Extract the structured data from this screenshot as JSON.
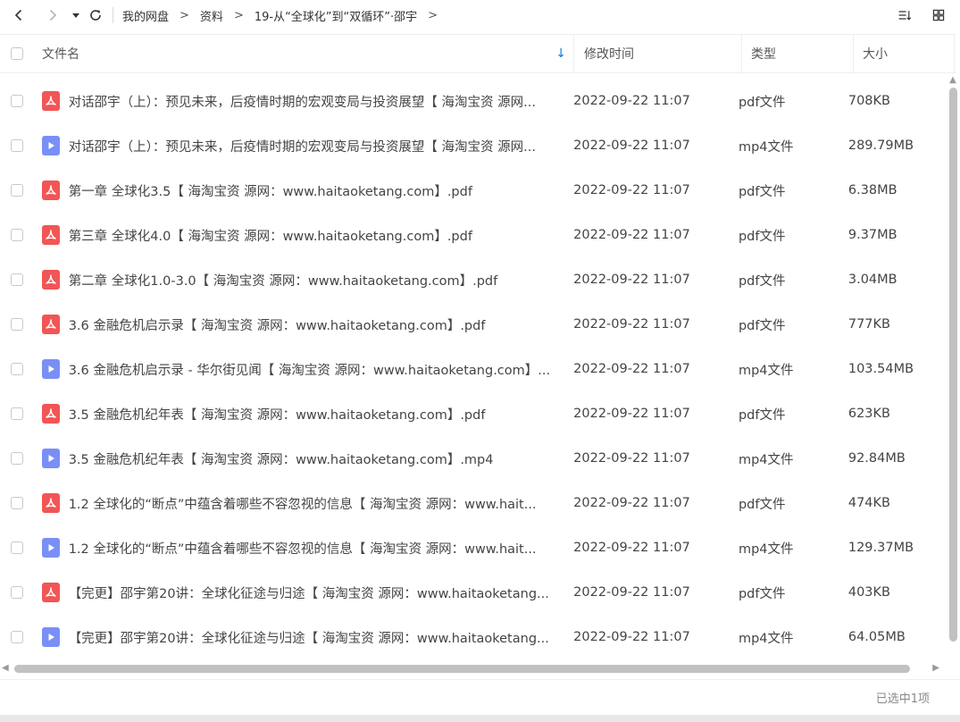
{
  "toolbar": {
    "back_icon": "chevron-left-icon",
    "forward_icon": "chevron-right-icon",
    "history_icon": "caret-down-icon",
    "refresh_icon": "refresh-icon",
    "breadcrumbs": [
      "我的网盘",
      "资料",
      "19-从“全球化”到“双循环”·邵宇"
    ],
    "sort_icon": "sort-list-icon",
    "grid_icon": "grid-view-icon"
  },
  "header": {
    "name": "文件名",
    "time": "修改时间",
    "type": "类型",
    "size": "大小"
  },
  "files": [
    {
      "name": "对话邵宇（上）：预见未来，后疫情时期的宏观变局与投资展望【 海淘宝资 源网...",
      "time": "2022-09-22 11:07",
      "type": "pdf文件",
      "size": "708KB",
      "kind": "pdf"
    },
    {
      "name": "对话邵宇（上）：预见未来，后疫情时期的宏观变局与投资展望【 海淘宝资 源网...",
      "time": "2022-09-22 11:07",
      "type": "mp4文件",
      "size": "289.79MB",
      "kind": "mp4"
    },
    {
      "name": "第一章 全球化3.5【 海淘宝资 源网：www.haitaoketang.com】.pdf",
      "time": "2022-09-22 11:07",
      "type": "pdf文件",
      "size": "6.38MB",
      "kind": "pdf"
    },
    {
      "name": "第三章 全球化4.0【 海淘宝资 源网：www.haitaoketang.com】.pdf",
      "time": "2022-09-22 11:07",
      "type": "pdf文件",
      "size": "9.37MB",
      "kind": "pdf"
    },
    {
      "name": "第二章 全球化1.0-3.0【 海淘宝资 源网：www.haitaoketang.com】.pdf",
      "time": "2022-09-22 11:07",
      "type": "pdf文件",
      "size": "3.04MB",
      "kind": "pdf"
    },
    {
      "name": "3.6 金融危机启示录【 海淘宝资 源网：www.haitaoketang.com】.pdf",
      "time": "2022-09-22 11:07",
      "type": "pdf文件",
      "size": "777KB",
      "kind": "pdf"
    },
    {
      "name": "3.6 金融危机启示录 - 华尔街见闻【 海淘宝资 源网：www.haitaoketang.com】...",
      "time": "2022-09-22 11:07",
      "type": "mp4文件",
      "size": "103.54MB",
      "kind": "mp4"
    },
    {
      "name": "3.5 金融危机纪年表【 海淘宝资 源网：www.haitaoketang.com】.pdf",
      "time": "2022-09-22 11:07",
      "type": "pdf文件",
      "size": "623KB",
      "kind": "pdf"
    },
    {
      "name": "3.5 金融危机纪年表【 海淘宝资 源网：www.haitaoketang.com】.mp4",
      "time": "2022-09-22 11:07",
      "type": "mp4文件",
      "size": "92.84MB",
      "kind": "mp4"
    },
    {
      "name": "1.2 全球化的“断点”中蕴含着哪些不容忽视的信息【 海淘宝资 源网：www.hait...",
      "time": "2022-09-22 11:07",
      "type": "pdf文件",
      "size": "474KB",
      "kind": "pdf"
    },
    {
      "name": "1.2 全球化的“断点”中蕴含着哪些不容忽视的信息【 海淘宝资 源网：www.hait...",
      "time": "2022-09-22 11:07",
      "type": "mp4文件",
      "size": "129.37MB",
      "kind": "mp4"
    },
    {
      "name": "【完更】邵宇第20讲：全球化征途与归途【 海淘宝资 源网：www.haitaoketang...",
      "time": "2022-09-22 11:07",
      "type": "pdf文件",
      "size": "403KB",
      "kind": "pdf"
    },
    {
      "name": "【完更】邵宇第20讲：全球化征途与归途【 海淘宝资 源网：www.haitaoketang...",
      "time": "2022-09-22 11:07",
      "type": "mp4文件",
      "size": "64.05MB",
      "kind": "mp4"
    }
  ],
  "status": {
    "selected_text": "已选中1项"
  },
  "colors": {
    "pdf_icon": "#f25555",
    "mp4_icon": "#7a8ff5",
    "sort_accent": "#0c7ddf"
  }
}
